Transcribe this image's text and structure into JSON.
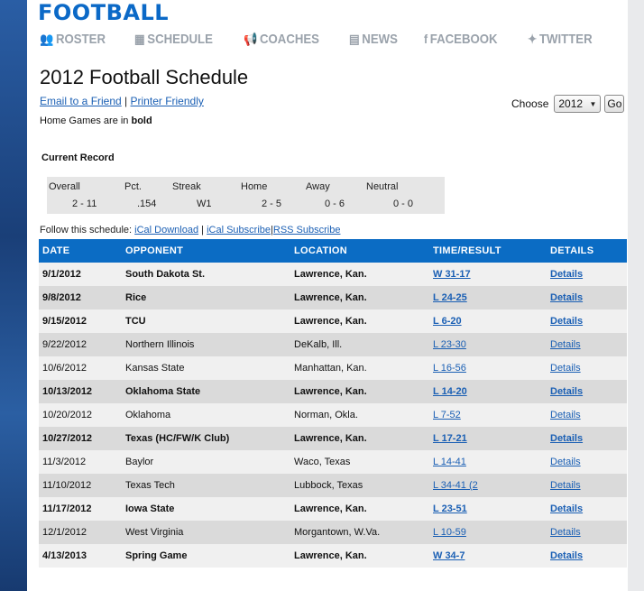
{
  "site": {
    "title": "FOOTBALL"
  },
  "nav": [
    {
      "label": "ROSTER",
      "icon": "users-icon",
      "glyph": "👥"
    },
    {
      "label": "SCHEDULE",
      "icon": "table-icon",
      "glyph": "▦"
    },
    {
      "label": "COACHES",
      "icon": "megaphone-icon",
      "glyph": "📢"
    },
    {
      "label": "NEWS",
      "icon": "newspaper-icon",
      "glyph": "▤"
    },
    {
      "label": "FACEBOOK",
      "icon": "facebook-icon",
      "glyph": "f"
    },
    {
      "label": "TWITTER",
      "icon": "twitter-icon",
      "glyph": "✦"
    }
  ],
  "page_title": "2012 Football Schedule",
  "links": {
    "email": "Email to a Friend",
    "sep": "|",
    "printer": "Printer Friendly"
  },
  "home_note": {
    "prefix": "Home Games are in ",
    "bold": "bold"
  },
  "chooser": {
    "label": "Choose",
    "selected": "2012",
    "go": "Go"
  },
  "record": {
    "heading": "Current Record",
    "labels": [
      "Overall",
      "Pct.",
      "Streak",
      "Home",
      "Away",
      "Neutral"
    ],
    "values": [
      "2 - 11",
      ".154",
      "W1",
      "2 - 5",
      "0 - 6",
      "0 - 0"
    ]
  },
  "follow": {
    "prefix": "Follow this schedule: ",
    "ical_download": "iCal Download",
    "sep1": " | ",
    "ical_subscribe": "iCal Subscribe",
    "sep2": "|",
    "rss": "RSS Subscribe"
  },
  "table": {
    "headers": [
      "DATE",
      "OPPONENT",
      "LOCATION",
      "TIME/RESULT",
      "DETAILS"
    ],
    "rows": [
      {
        "date": "9/1/2012",
        "opponent": "South Dakota St.",
        "location": "Lawrence, Kan.",
        "result": "W 31-17",
        "details": "Details",
        "home": true
      },
      {
        "date": "9/8/2012",
        "opponent": "Rice",
        "location": "Lawrence, Kan.",
        "result": "L 24-25",
        "details": "Details",
        "home": true
      },
      {
        "date": "9/15/2012",
        "opponent": "TCU",
        "location": "Lawrence, Kan.",
        "result": "L 6-20",
        "details": "Details",
        "home": true
      },
      {
        "date": "9/22/2012",
        "opponent": "Northern Illinois",
        "location": "DeKalb, Ill.",
        "result": "L 23-30",
        "details": "Details",
        "home": false
      },
      {
        "date": "10/6/2012",
        "opponent": "Kansas State",
        "location": "Manhattan, Kan.",
        "result": "L 16-56",
        "details": "Details",
        "home": false
      },
      {
        "date": "10/13/2012",
        "opponent": "Oklahoma State",
        "location": "Lawrence, Kan.",
        "result": "L 14-20",
        "details": "Details",
        "home": true
      },
      {
        "date": "10/20/2012",
        "opponent": "Oklahoma",
        "location": "Norman, Okla.",
        "result": "L 7-52",
        "details": "Details",
        "home": false
      },
      {
        "date": "10/27/2012",
        "opponent": "Texas (HC/FW/K Club)",
        "location": "Lawrence, Kan.",
        "result": "L 17-21",
        "details": "Details",
        "home": true
      },
      {
        "date": "11/3/2012",
        "opponent": "Baylor",
        "location": "Waco, Texas",
        "result": "L 14-41",
        "details": "Details",
        "home": false
      },
      {
        "date": "11/10/2012",
        "opponent": "Texas Tech",
        "location": "Lubbock, Texas",
        "result": "L 34-41 (2",
        "details": "Details",
        "home": false
      },
      {
        "date": "11/17/2012",
        "opponent": "Iowa State",
        "location": "Lawrence, Kan.",
        "result": "L 23-51",
        "details": "Details",
        "home": true
      },
      {
        "date": "12/1/2012",
        "opponent": "West Virginia",
        "location": "Morgantown, W.Va.",
        "result": "L 10-59",
        "details": "Details",
        "home": false
      },
      {
        "date": "4/13/2013",
        "opponent": "Spring Game",
        "location": "Lawrence, Kan.",
        "result": "W 34-7",
        "details": "Details",
        "home": true
      }
    ]
  }
}
